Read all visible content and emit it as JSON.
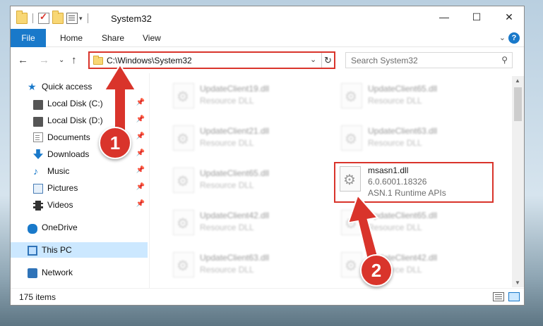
{
  "window": {
    "title": "System32",
    "minimize_icon": "minimize-icon",
    "maximize_icon": "maximize-icon",
    "close_icon": "close-icon"
  },
  "ribbon": {
    "tabs": [
      "File",
      "Home",
      "Share",
      "View"
    ]
  },
  "nav": {
    "address": "C:\\Windows\\System32",
    "search_placeholder": "Search System32"
  },
  "sidebar": {
    "items": [
      {
        "label": "Quick access",
        "icon": "star-icon"
      },
      {
        "label": "Local Disk (C:)",
        "icon": "drive-icon"
      },
      {
        "label": "Local Disk (D:)",
        "icon": "drive-icon"
      },
      {
        "label": "Documents",
        "icon": "documents-icon"
      },
      {
        "label": "Downloads",
        "icon": "downloads-icon"
      },
      {
        "label": "Music",
        "icon": "music-icon"
      },
      {
        "label": "Pictures",
        "icon": "pictures-icon"
      },
      {
        "label": "Videos",
        "icon": "videos-icon"
      },
      {
        "label": "OneDrive",
        "icon": "onedrive-icon"
      },
      {
        "label": "This PC",
        "icon": "this-pc-icon"
      },
      {
        "label": "Network",
        "icon": "network-icon"
      }
    ]
  },
  "files": {
    "left": [
      {
        "name": "UpdateClient19.dll",
        "desc": "Resource DLL"
      },
      {
        "name": "UpdateClient21.dll",
        "desc": "Resource DLL"
      },
      {
        "name": "UpdateClient65.dll",
        "desc": "Resource DLL"
      },
      {
        "name": "UpdateClient42.dll",
        "desc": "Resource DLL"
      },
      {
        "name": "UpdateClient63.dll",
        "desc": "Resource DLL"
      }
    ],
    "right": [
      {
        "name": "UpdateClient65.dll",
        "desc": "Resource DLL"
      },
      {
        "name": "UpdateClient63.dll",
        "desc": "Resource DLL"
      },
      {
        "name": "msasn1.dll",
        "version": "6.0.6001.18326",
        "desc": "ASN.1 Runtime APIs"
      },
      {
        "name": "UpdateClient65.dll",
        "desc": "Resource DLL"
      },
      {
        "name": "UpdateClient42.dll",
        "desc": "Resource DLL"
      }
    ]
  },
  "status": {
    "count": "175 items"
  },
  "annotations": {
    "step1": "1",
    "step2": "2",
    "color": "#d9342b"
  },
  "colors": {
    "accent": "#1979ca",
    "selected_bg": "#cce8ff",
    "highlight": "#d9342b"
  }
}
